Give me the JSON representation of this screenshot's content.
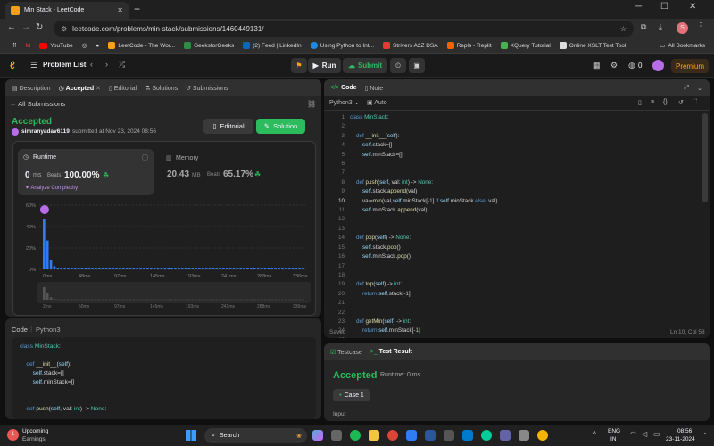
{
  "browser": {
    "tab_title": "Min Stack - LeetCode",
    "url": "leetcode.com/problems/min-stack/submissions/1460449131/",
    "avatar": "S"
  },
  "bookmarks": [
    "YouTube",
    "LeetCode - The Wor...",
    "GeeksforGeeks",
    "(2) Feed | LinkedIn",
    "Using Python to Int...",
    "Strivers A2Z DSA",
    "Repls - Replit",
    "XQuery Tutorial",
    "Online XSLT Test Tool",
    "All Bookmarks"
  ],
  "nav": {
    "problem_list": "Problem List",
    "run": "Run",
    "submit": "Submit",
    "streak": "0",
    "premium": "Premium"
  },
  "left_tabs": [
    "Description",
    "Accepted",
    "Editorial",
    "Solutions",
    "Submissions"
  ],
  "submission": {
    "back": "All Submissions",
    "status": "Accepted",
    "user": "simranyadav6119",
    "submitted": "submitted at Nov 23, 2024 08:56",
    "editorial_btn": "Editorial",
    "solution_btn": "Solution"
  },
  "runtime": {
    "label": "Runtime",
    "value": "0",
    "unit": "ms",
    "beats_label": "Beats",
    "beats": "100.00%",
    "analyze": "Analyze Complexity"
  },
  "memory": {
    "label": "Memory",
    "value": "20.43",
    "unit": "MB",
    "beats_label": "Beats",
    "beats": "65.17%"
  },
  "chart_data": {
    "type": "bar",
    "title": "",
    "xlabel": "",
    "ylabel": "",
    "y_ticks": [
      "60%",
      "40%",
      "20%",
      "0%"
    ],
    "ylim": [
      0,
      60
    ],
    "x_ticks": [
      "0ms",
      "48ms",
      "97ms",
      "145ms",
      "193ms",
      "241ms",
      "288ms",
      "336ms"
    ],
    "mini_ticks": [
      "2ms",
      "50ms",
      "97ms",
      "145ms",
      "193ms",
      "241ms",
      "288ms",
      "336ms"
    ],
    "values": [
      47,
      27,
      9,
      3,
      1.5,
      1,
      1,
      1,
      1,
      1,
      1,
      1,
      1,
      1,
      1,
      1,
      1,
      1,
      1,
      1,
      1,
      1,
      1,
      1,
      1,
      1,
      1,
      1,
      1,
      1,
      1,
      1,
      1,
      1,
      1,
      1,
      1,
      1,
      1,
      1,
      1,
      1,
      1,
      1,
      1,
      1,
      1,
      1,
      1,
      1,
      1,
      1,
      1,
      1,
      1,
      1,
      1,
      1,
      1,
      1,
      1,
      1,
      1,
      1,
      1,
      1,
      1,
      1,
      1,
      1,
      1,
      1,
      1,
      1,
      1,
      1
    ],
    "color": "#2f7cf5",
    "highlight_index": 0
  },
  "bottom_code": {
    "label": "Code",
    "lang": "Python3",
    "lines": [
      "class MinStack:",
      "",
      "    def __init__(self):",
      "        self.stack=[]",
      "        self.minStack=[]",
      "",
      "",
      "    def push(self, val: int) -> None:"
    ]
  },
  "editor": {
    "tab_code": "Code",
    "tab_note": "Note",
    "lang": "Python3",
    "auto": "Auto",
    "saved": "Saved",
    "cursor": "Ln 10, Col 58",
    "lines": [
      "class MinStack:",
      "",
      "    def __init__(self):",
      "        self.stack=[]",
      "        self.minStack=[]",
      "",
      "",
      "    def push(self, val: int) -> None:",
      "        self.stack.append(val)",
      "        val=min(val,self.minStack[-1] if self.minStack else  val)",
      "        self.minStack.append(val)",
      "",
      "",
      "    def pop(self) -> None:",
      "        self.stack.pop()",
      "        self.minStack.pop()",
      "",
      "",
      "    def top(self) -> int:",
      "        return self.stack[-1]",
      "",
      "",
      "    def getMin(self) -> int:",
      "        return self.minStack[-1]",
      ""
    ]
  },
  "result": {
    "tab_testcase": "Testcase",
    "tab_result": "Test Result",
    "status": "Accepted",
    "runtime": "Runtime: 0 ms",
    "case": "Case 1",
    "input": "Input"
  },
  "taskbar": {
    "weather_title": "Upcoming",
    "weather_sub": "Earnings",
    "search": "Search",
    "lang1": "ENG",
    "lang2": "IN",
    "time": "08:56",
    "date": "23-11-2024"
  }
}
